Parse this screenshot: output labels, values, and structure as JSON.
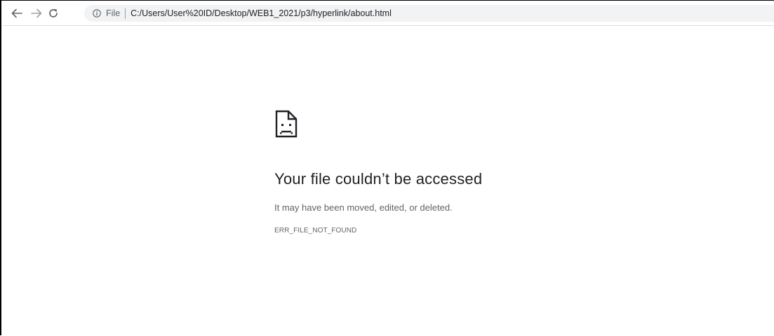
{
  "browser": {
    "nav": {
      "back_icon": "arrow-left-icon",
      "forward_icon": "arrow-right-icon",
      "reload_icon": "reload-icon"
    },
    "omnibox": {
      "info_icon": "info-icon",
      "scheme_label": "File",
      "url": "C:/Users/User%20ID/Desktop/WEB1_2021/p3/hyperlink/about.html"
    }
  },
  "error_page": {
    "icon": "sad-file-icon",
    "title": "Your file couldn’t be accessed",
    "description": "It may have been moved, edited, or deleted.",
    "code": "ERR_FILE_NOT_FOUND"
  },
  "colors": {
    "toolbar_bg": "#ffffff",
    "omnibox_bg": "#f1f3f4",
    "title_text": "#202124",
    "secondary_text": "#5f6368"
  }
}
